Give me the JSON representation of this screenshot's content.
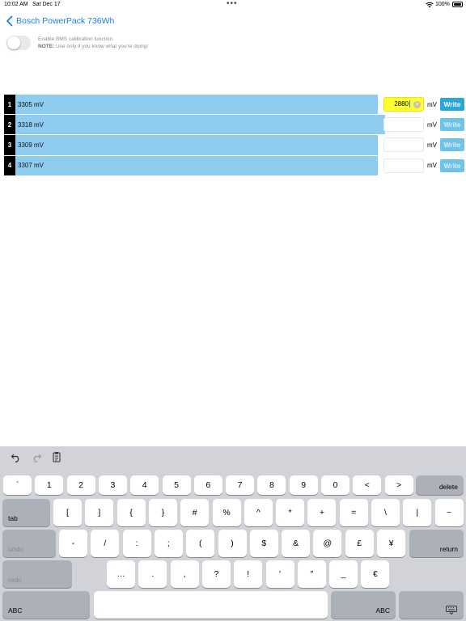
{
  "status_bar": {
    "time": "10:02 AM",
    "date": "Sat Dec 17",
    "battery": "100%"
  },
  "nav": {
    "back_label": "Bosch PowerPack 736Wh"
  },
  "calibration": {
    "enabled": false,
    "line1": "Enable BMS calibration function.",
    "note_label": "NOTE:",
    "note_text": " Use only if you know what you're doing!"
  },
  "cells": [
    {
      "index": "1",
      "voltage": "3305 mV",
      "level": 0.805,
      "input": "2880",
      "active": true,
      "unit": "mV",
      "button": "Write",
      "enabled": true
    },
    {
      "index": "2",
      "voltage": "3318 mV",
      "level": 0.821,
      "input": "",
      "active": false,
      "unit": "mV",
      "button": "Write",
      "enabled": false
    },
    {
      "index": "3",
      "voltage": "3309 mV",
      "level": 0.805,
      "input": "",
      "active": false,
      "unit": "mV",
      "button": "Write",
      "enabled": false
    },
    {
      "index": "4",
      "voltage": "3307 mV",
      "level": 0.805,
      "input": "",
      "active": false,
      "unit": "mV",
      "button": "Write",
      "enabled": false
    }
  ],
  "keyboard": {
    "row1": [
      "`",
      "1",
      "2",
      "3",
      "4",
      "5",
      "6",
      "7",
      "8",
      "9",
      "0",
      "<",
      ">"
    ],
    "delete": "delete",
    "tab": "tab",
    "row2": [
      "[",
      "]",
      "{",
      "}",
      "#",
      "%",
      "^",
      "*",
      "+",
      "=",
      "\\",
      "|",
      "~"
    ],
    "undo": "undo",
    "row3": [
      "-",
      "/",
      ":",
      ";",
      "(",
      ")",
      "$",
      "&",
      "@",
      "£",
      "¥"
    ],
    "return": "return",
    "redo": "redo",
    "row4": [
      "…",
      ".",
      ",",
      "?",
      "!",
      "′",
      "″",
      "_",
      "€"
    ],
    "abc_left": "ABC",
    "abc_right": "ABC"
  }
}
